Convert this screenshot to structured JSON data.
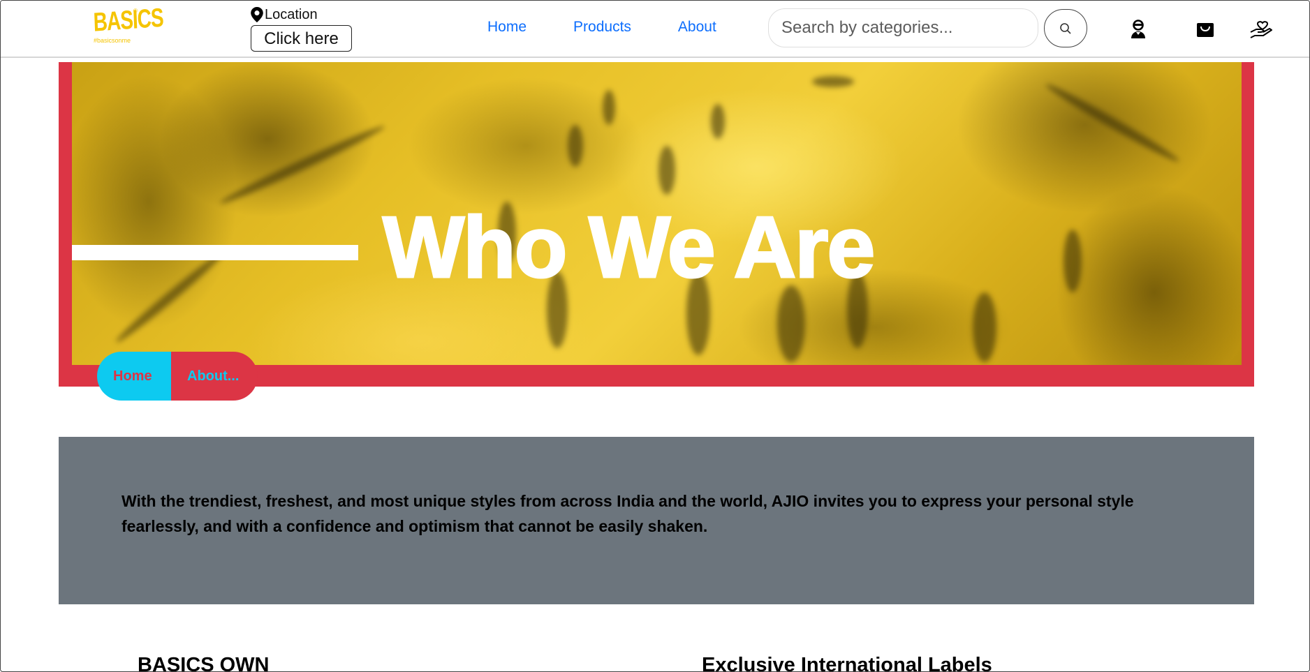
{
  "brand": {
    "logo_word": "BASICS",
    "logo_tagline": "#basicsonme",
    "color": "#f5c400"
  },
  "location": {
    "label": "Location",
    "button_label": "Click here",
    "icon": "map-pin-icon"
  },
  "nav": {
    "links": [
      {
        "label": "Home"
      },
      {
        "label": "Products"
      },
      {
        "label": "About"
      }
    ],
    "link_color": "#0d6efd"
  },
  "search": {
    "placeholder": "Search by categories...",
    "button_icon": "search-icon"
  },
  "header_icons": [
    "user-icon",
    "shopping-bag-icon",
    "handshake-icon"
  ],
  "hero": {
    "title": "Who We Are",
    "frame_color": "#dc3545",
    "image_tint": "#e6bf26"
  },
  "breadcrumb": {
    "items": [
      {
        "label": "Home",
        "bg": "#0dcaf0",
        "color": "#dc3545"
      },
      {
        "label": "About...",
        "bg": "#dc3545",
        "color": "#0dcaf0"
      }
    ]
  },
  "info": {
    "text": "With the trendiest, freshest, and most unique styles from across India and the world, AJIO invites you to express your personal style fearlessly, and with a confidence and optimism that cannot be easily shaken.",
    "bg": "#6c757d"
  },
  "sections": [
    {
      "heading": "BASICS OWN"
    },
    {
      "heading": "Exclusive International Labels"
    }
  ]
}
